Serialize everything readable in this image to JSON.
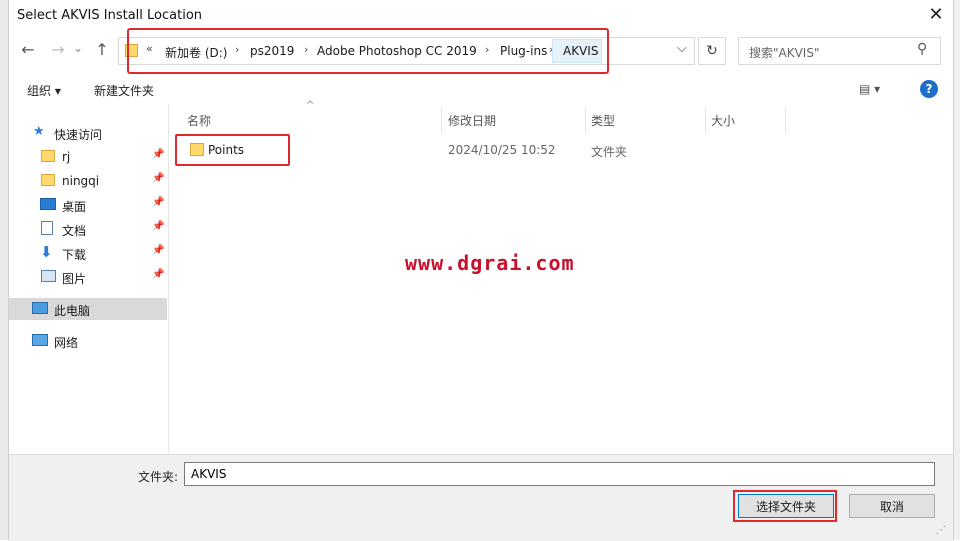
{
  "window": {
    "title": "Select AKVIS Install Location",
    "close_glyph": "✕"
  },
  "nav": {
    "back": "←",
    "forward": "→",
    "history": "⌄",
    "up": "↑"
  },
  "address": {
    "overflow": "«",
    "crumbs": [
      "新加卷 (D:)",
      "ps2019",
      "Adobe Photoshop CC 2019",
      "Plug-ins",
      "AKVIS"
    ],
    "dropdown": "⌵",
    "refresh": "↻"
  },
  "search": {
    "placeholder": "搜索\"AKVIS\"",
    "icon": "search-icon"
  },
  "toolbar": {
    "organize": "组织 ▾",
    "new_folder": "新建文件夹",
    "view": "▤ ▾",
    "help": "?"
  },
  "sidebar": {
    "quick_access": "快速访问",
    "items": [
      {
        "label": "rj",
        "icon": "folder-icon"
      },
      {
        "label": "ningqi",
        "icon": "folder-icon"
      },
      {
        "label": "桌面",
        "icon": "desktop-icon"
      },
      {
        "label": "文档",
        "icon": "document-icon"
      },
      {
        "label": "下载",
        "icon": "download-icon"
      },
      {
        "label": "图片",
        "icon": "picture-icon"
      }
    ],
    "this_pc": "此电脑",
    "network": "网络"
  },
  "columns": {
    "name": "名称",
    "date": "修改日期",
    "type": "类型",
    "size": "大小"
  },
  "files": [
    {
      "name": "Points",
      "date": "2024/10/25 10:52",
      "type": "文件夹",
      "size": ""
    }
  ],
  "watermark": "www.dgrai.com",
  "footer": {
    "folder_label": "文件夹:",
    "folder_value": "AKVIS",
    "select_button": "选择文件夹",
    "cancel_button": "取消"
  },
  "colors": {
    "highlight": "#e0292e",
    "accent": "#0078d7",
    "watermark": "#c8102e"
  }
}
